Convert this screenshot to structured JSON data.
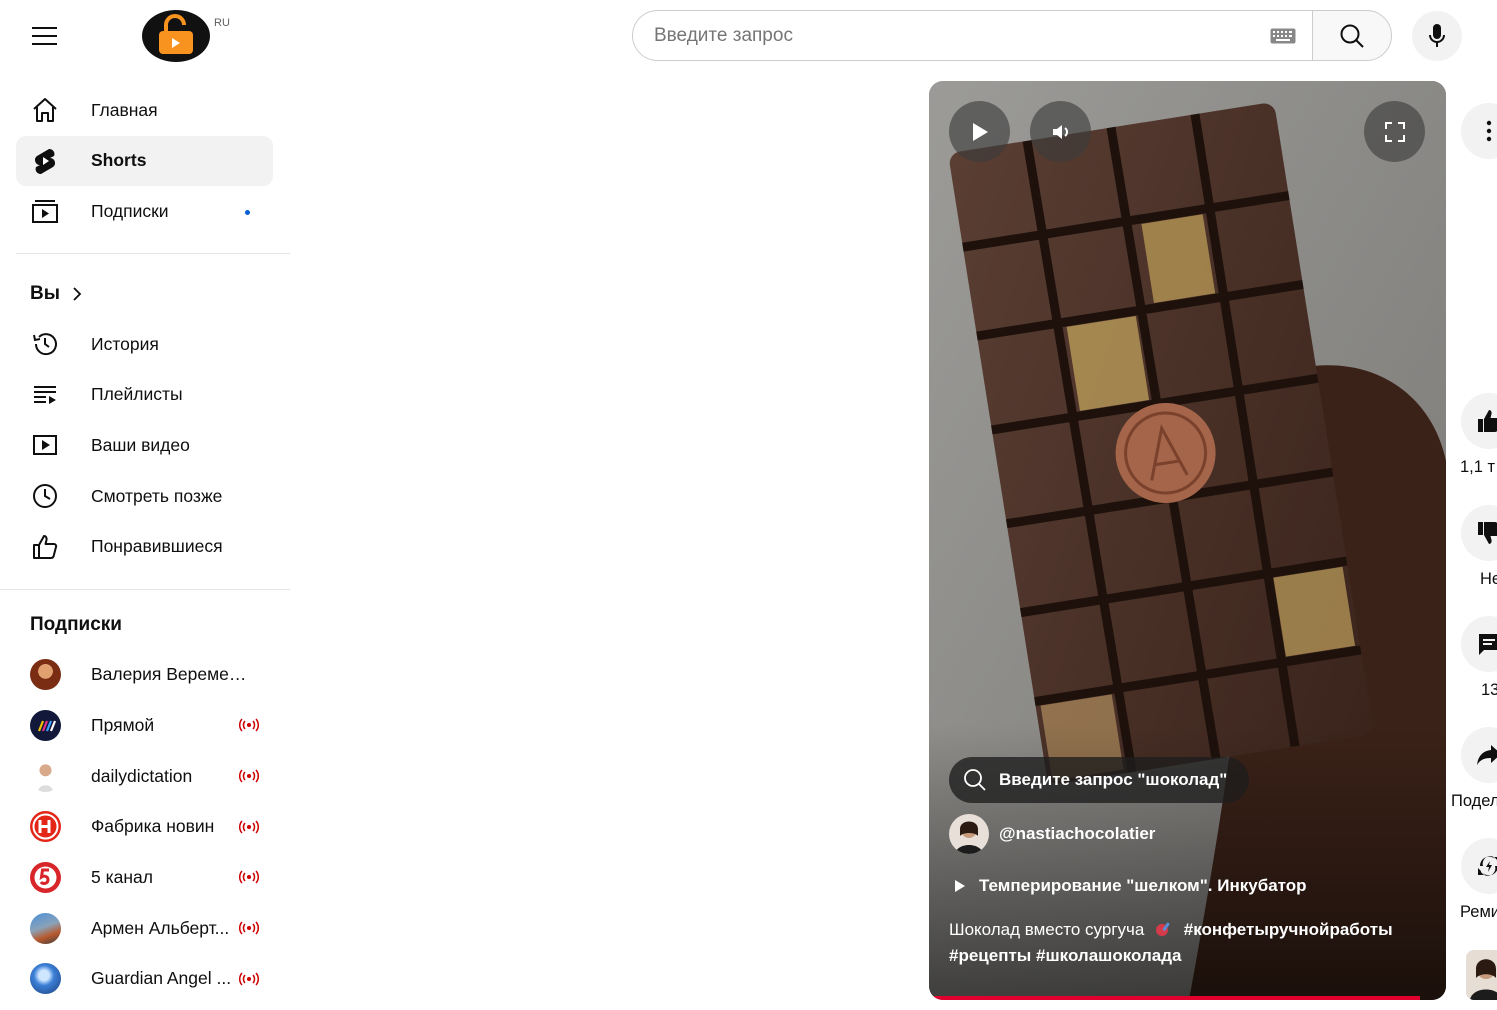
{
  "header": {
    "logo_region": "RU",
    "search_placeholder": "Введите запрос"
  },
  "sidebar": {
    "main_items": [
      {
        "label": "Главная",
        "icon": "home-icon"
      },
      {
        "label": "Shorts",
        "icon": "shorts-icon",
        "active": true
      },
      {
        "label": "Подписки",
        "icon": "subscriptions-icon",
        "has_new_dot": true
      }
    ],
    "you_section": {
      "title": "Вы",
      "items": [
        {
          "label": "История",
          "icon": "history-icon"
        },
        {
          "label": "Плейлисты",
          "icon": "playlists-icon"
        },
        {
          "label": "Ваши видео",
          "icon": "your-videos-icon"
        },
        {
          "label": "Смотреть позже",
          "icon": "watch-later-icon"
        },
        {
          "label": "Понравившиеся",
          "icon": "liked-icon"
        }
      ]
    },
    "subscriptions": {
      "title": "Подписки",
      "items": [
        {
          "label": "Валерия Веремее...",
          "live": false
        },
        {
          "label": "Прямой",
          "live": true
        },
        {
          "label": "dailydictation",
          "live": true
        },
        {
          "label": "Фабрика новин",
          "live": true
        },
        {
          "label": "5 канал",
          "live": true
        },
        {
          "label": "Армен Альберт...",
          "live": true
        },
        {
          "label": "Guardian Angel ...",
          "live": true
        }
      ]
    }
  },
  "player": {
    "search_suggestion": "Введите запрос \"шоколад\"",
    "channel_handle": "@nastiachocolatier",
    "playlist": "Темперирование \"шелком\". Инкубатор",
    "caption_text": "Шоколад вместо сургуча",
    "caption_tags_1": "#конфетыручнойработы",
    "caption_tags_2": "#рецепты #школашоколада",
    "progress": 0.95
  },
  "actions": {
    "likes": "1,1 т",
    "dislike": "Не",
    "comments": "13",
    "share": "Подел",
    "remix": "Реми"
  }
}
